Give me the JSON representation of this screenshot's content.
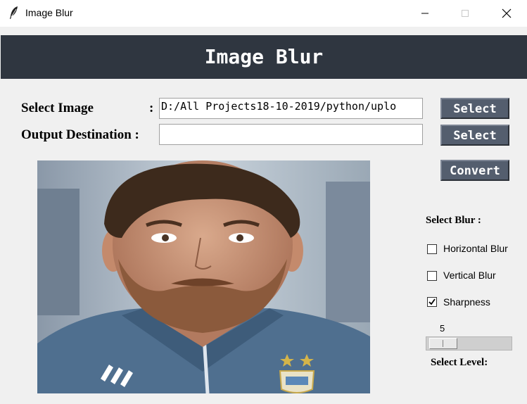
{
  "window": {
    "title": "Image Blur"
  },
  "banner": {
    "title": "Image Blur"
  },
  "form": {
    "select_image_label": "Select Image",
    "select_image_colon": ":",
    "select_image_value": "D:/All Projects18-10-2019/python/uplo",
    "output_label": "Output Destination :",
    "output_value": "",
    "select_button_1": "Select",
    "select_button_2": "Select",
    "convert_button": "Convert"
  },
  "blur_panel": {
    "heading": "Select Blur :",
    "options": [
      {
        "label": "Horizontal Blur",
        "checked": false
      },
      {
        "label": "Vertical Blur",
        "checked": false
      },
      {
        "label": "Sharpness",
        "checked": true
      }
    ],
    "level_value": "5",
    "level_fraction": 0.05,
    "level_label": "Select Level:"
  },
  "colors": {
    "banner_bg": "#2f3640",
    "button_bg": "#545e6e",
    "window_bg": "#f0f0f0"
  },
  "icons": {
    "app": "feather-icon",
    "minimize": "minimize-icon",
    "maximize": "maximize-icon",
    "close": "close-icon"
  }
}
